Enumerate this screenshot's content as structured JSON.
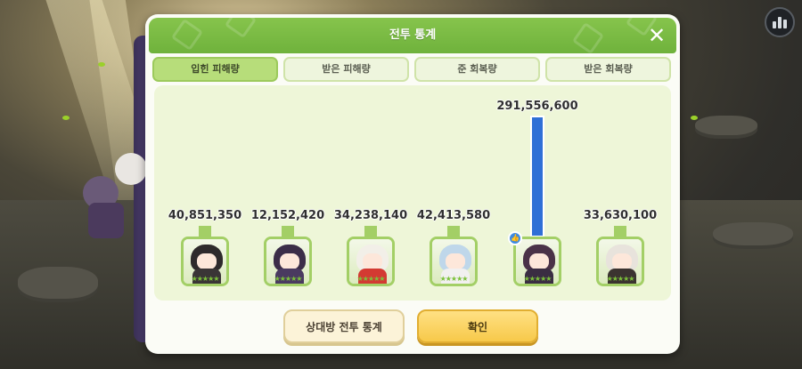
{
  "dialog": {
    "title": "전투 통계",
    "close_icon": "close-icon"
  },
  "tabs": [
    {
      "label": "입힌 피해량",
      "active": true
    },
    {
      "label": "받은 피해량",
      "active": false
    },
    {
      "label": "준 회복량",
      "active": false
    },
    {
      "label": "받은 회복량",
      "active": false
    }
  ],
  "chart_data": {
    "type": "bar",
    "categories": [
      "character-1",
      "character-2",
      "character-3",
      "character-4",
      "character-5",
      "character-6"
    ],
    "values": [
      40851350,
      12152420,
      34238140,
      42413580,
      291556600,
      33630100
    ],
    "value_labels": [
      "40,851,350",
      "12,152,420",
      "34,238,140",
      "42,413,580",
      "291,556,600",
      "33,630,100"
    ],
    "max_highlight_index": 4,
    "bar_color_max": "#2f6fd6",
    "bar_color": "#a3cf66"
  },
  "characters": [
    {
      "name": "character-1",
      "hair": "#2e2a2c",
      "cloth": "#3a3536",
      "stars": "★★★★★"
    },
    {
      "name": "character-2",
      "hair": "#3b2d48",
      "cloth": "#4a3a60",
      "stars": "★★★★★"
    },
    {
      "name": "character-3",
      "hair": "#f2efe8",
      "cloth": "#d33a32",
      "stars": "★★★★★"
    },
    {
      "name": "character-4",
      "hair": "#bfd7ea",
      "cloth": "#f2f0f0",
      "stars": "★★★★★"
    },
    {
      "name": "character-5",
      "hair": "#4a3248",
      "cloth": "#3a2d42",
      "stars": "★★★★★",
      "mvp": true
    },
    {
      "name": "character-6",
      "hair": "#e8e3dc",
      "cloth": "#3b3330",
      "stars": "★★★★★"
    }
  ],
  "buttons": {
    "opponent_stats": "상대방 전투 통계",
    "confirm": "확인"
  },
  "icons": {
    "stats": "bar-chart-icon",
    "thumb": "thumbs-up-icon"
  }
}
